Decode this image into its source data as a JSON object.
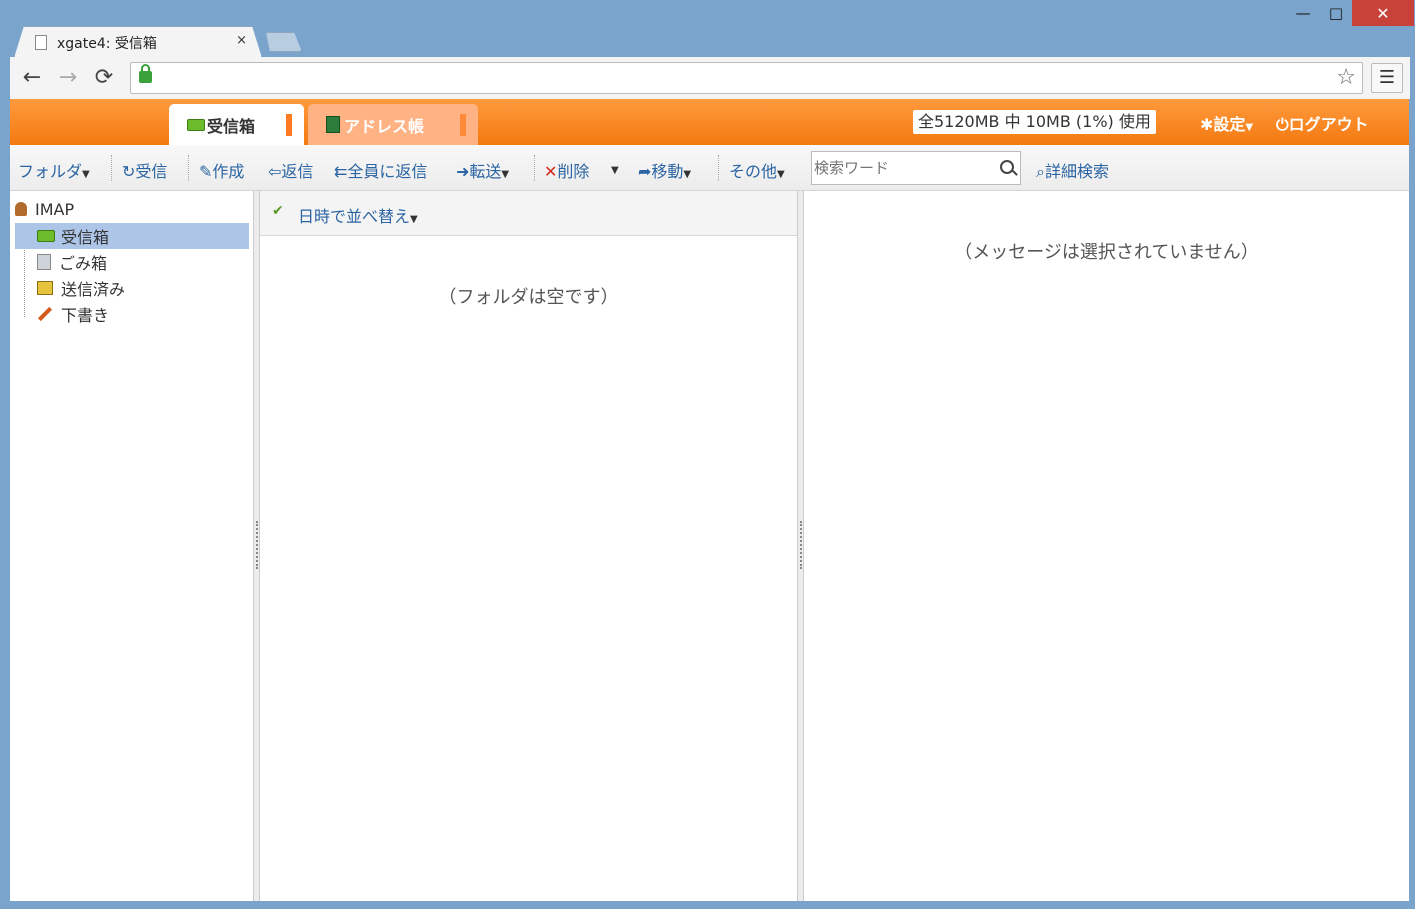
{
  "window": {
    "min_glyph": "—",
    "max_glyph": "□",
    "close_glyph": "✕"
  },
  "browser_tab": {
    "title": "xgate4: 受信箱",
    "close_glyph": "×"
  },
  "browser_toolbar": {
    "back_glyph": "←",
    "forward_glyph": "→",
    "reload_glyph": "⟳",
    "star_glyph": "☆",
    "menu_glyph": "☰"
  },
  "app_tabs": {
    "inbox": "受信箱",
    "address": "アドレス帳"
  },
  "header": {
    "quota": "全5120MB 中 10MB (1%) 使用",
    "settings": "設定",
    "logout": "ログアウト"
  },
  "actions": {
    "folder": "フォルダ",
    "receive": "受信",
    "compose": "作成",
    "reply": "返信",
    "reply_all": "全員に返信",
    "forward": "転送",
    "delete": "削除",
    "move": "移動",
    "other": "その他",
    "advanced_search": "詳細検索"
  },
  "search": {
    "placeholder": "検索ワード"
  },
  "folders": {
    "root": "IMAP",
    "items": [
      "受信箱",
      "ごみ箱",
      "送信済み",
      "下書き"
    ]
  },
  "message_list": {
    "sort_label": "日時で並べ替え",
    "empty_text": "（フォルダは空です）"
  },
  "preview": {
    "empty_text": "（メッセージは選択されていません）"
  },
  "colors": {
    "header_orange": "#f37a11",
    "link_blue": "#2b64a3",
    "selected_row": "#adc6e8",
    "close_red": "#c8423a"
  }
}
